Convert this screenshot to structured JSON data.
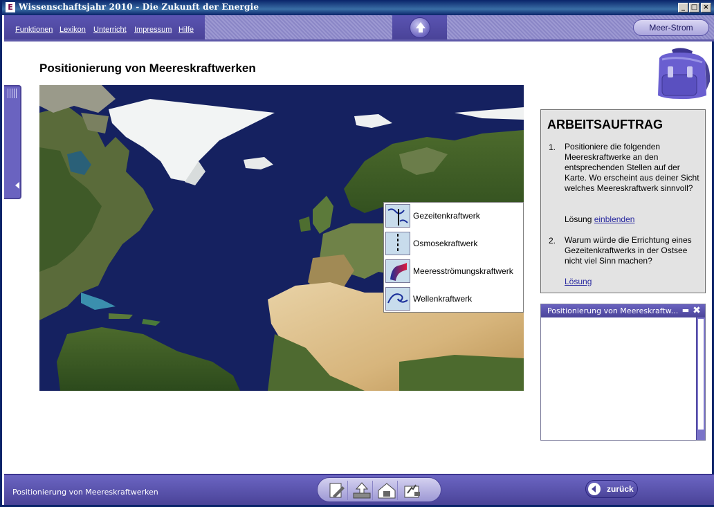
{
  "window": {
    "app_icon_letter": "E",
    "title": "Wissenschaftsjahr 2010 - Die Zukunft der Energie",
    "controls": [
      "_",
      "□",
      "×"
    ]
  },
  "menu": {
    "items": [
      "Funktionen",
      "Lexikon",
      "Unterricht",
      "Impressum",
      "Hilfe"
    ],
    "topic_button": "Meer-Strom"
  },
  "page": {
    "title": "Positionierung von Meereskraftwerken"
  },
  "legend": {
    "items": [
      {
        "label": "Gezeitenkraftwerk",
        "icon": "tide-icon"
      },
      {
        "label": "Osmosekraftwerk",
        "icon": "osmosis-icon"
      },
      {
        "label": "Meeresströmungskraftwerk",
        "icon": "current-icon"
      },
      {
        "label": "Wellenkraftwerk",
        "icon": "wave-icon"
      }
    ]
  },
  "task": {
    "heading": "ARBEITSAUFTRAG",
    "item1_num": "1.",
    "item1_text": "Positioniere die folgenden Meereskraftwerke an den entsprechenden Stellen auf der Karte. Wo erscheint aus deiner Sicht welches Meereskraftwerk sinnvoll?",
    "item1_solution_prefix": "Lösung",
    "item1_solution_link": "einblenden",
    "item2_num": "2.",
    "item2_text": "Warum würde die Errichtung eines Gezeitenkraftwerks in der Ostsee nicht viel Sinn machen?",
    "item2_solution_link": "Lösung"
  },
  "notes": {
    "title": "Positionierung von Meereskraftw..."
  },
  "footer": {
    "status": "Positionierung von Meereskraftwerken",
    "back_label": "zurück"
  },
  "colors": {
    "brand_purple": "#4a4398",
    "ocean": "#14205a"
  }
}
